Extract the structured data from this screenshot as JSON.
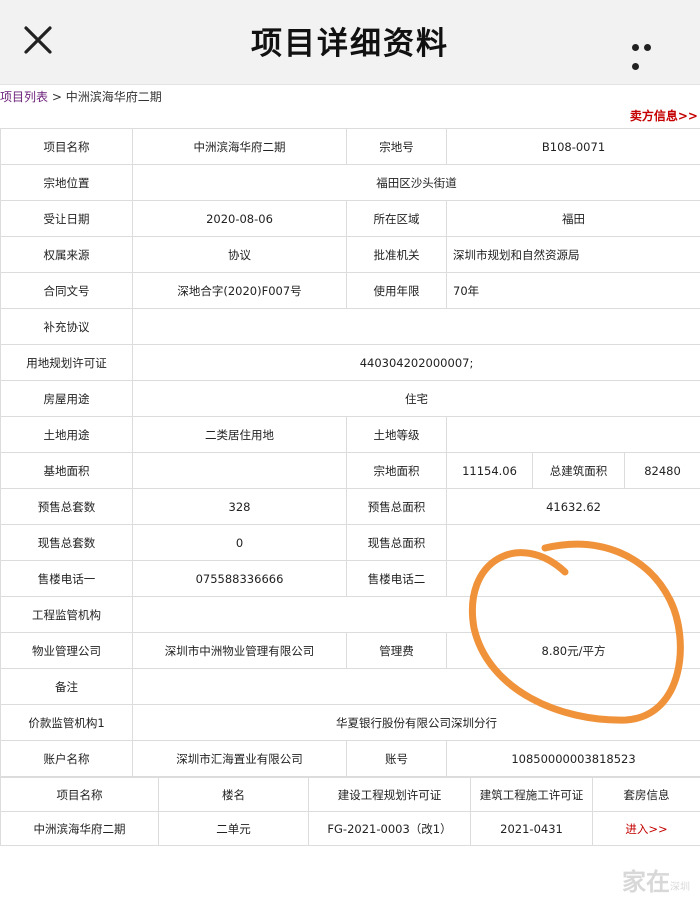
{
  "header": {
    "title": "项目详细资料"
  },
  "breadcrumb": {
    "list_link": "项目列表",
    "separator": " > ",
    "current": "中洲滨海华府二期"
  },
  "seller_link": "卖方信息>>",
  "detail": {
    "project_name_label": "项目名称",
    "project_name": "中洲滨海华府二期",
    "parcel_no_label": "宗地号",
    "parcel_no": "B108-0071",
    "parcel_location_label": "宗地位置",
    "parcel_location": "福田区沙头街道",
    "transfer_date_label": "受让日期",
    "transfer_date": "2020-08-06",
    "district_label": "所在区域",
    "district": "福田",
    "ownership_source_label": "权属来源",
    "ownership_source": "协议",
    "approval_authority_label": "批准机关",
    "approval_authority": "深圳市规划和自然资源局",
    "contract_no_label": "合同文号",
    "contract_no": "深地合字(2020)F007号",
    "use_years_label": "使用年限",
    "use_years": "70年",
    "supplement_label": "补充协议",
    "land_permit_label": "用地规划许可证",
    "land_permit": "440304202000007;",
    "house_use_label": "房屋用途",
    "house_use": "住宅",
    "land_use_label": "土地用途",
    "land_use": "二类居住用地",
    "land_grade_label": "土地等级",
    "base_area_label": "基地面积",
    "parcel_area_label": "宗地面积",
    "parcel_area": "11154.06",
    "total_build_area_label": "总建筑面积",
    "total_build_area": "82480",
    "presale_units_label": "预售总套数",
    "presale_units": "328",
    "presale_area_label": "预售总面积",
    "presale_area": "41632.62",
    "ready_units_label": "现售总套数",
    "ready_units": "0",
    "ready_area_label": "现售总面积",
    "sales_phone1_label": "售楼电话一",
    "sales_phone1": "075588336666",
    "sales_phone2_label": "售楼电话二",
    "supervision_org_label": "工程监管机构",
    "property_company_label": "物业管理公司",
    "property_company": "深圳市中洲物业管理有限公司",
    "mgmt_fee_label": "管理费",
    "mgmt_fee": "8.80元/平方",
    "remarks_label": "备注",
    "price_supervision_label": "价款监管机构1",
    "price_supervision": "华夏银行股份有限公司深圳分行",
    "account_name_label": "账户名称",
    "account_name": "深圳市汇海置业有限公司",
    "account_no_label": "账号",
    "account_no": "10850000003818523"
  },
  "units_table": {
    "headers": [
      "项目名称",
      "楼名",
      "建设工程规划许可证",
      "建筑工程施工许可证",
      "套房信息"
    ],
    "rows": [
      {
        "project_name": "中洲滨海华府二期",
        "building": "二单元",
        "plan_permit": "FG-2021-0003（改1）",
        "construction_permit": "2021-0431",
        "unit_link": "进入>>"
      }
    ]
  },
  "watermark": {
    "text": "家在",
    "sub": "深圳"
  },
  "colors": {
    "link_red": "#c40000",
    "link_purple": "#6b1f7a",
    "annotation_orange": "#f0923a"
  }
}
